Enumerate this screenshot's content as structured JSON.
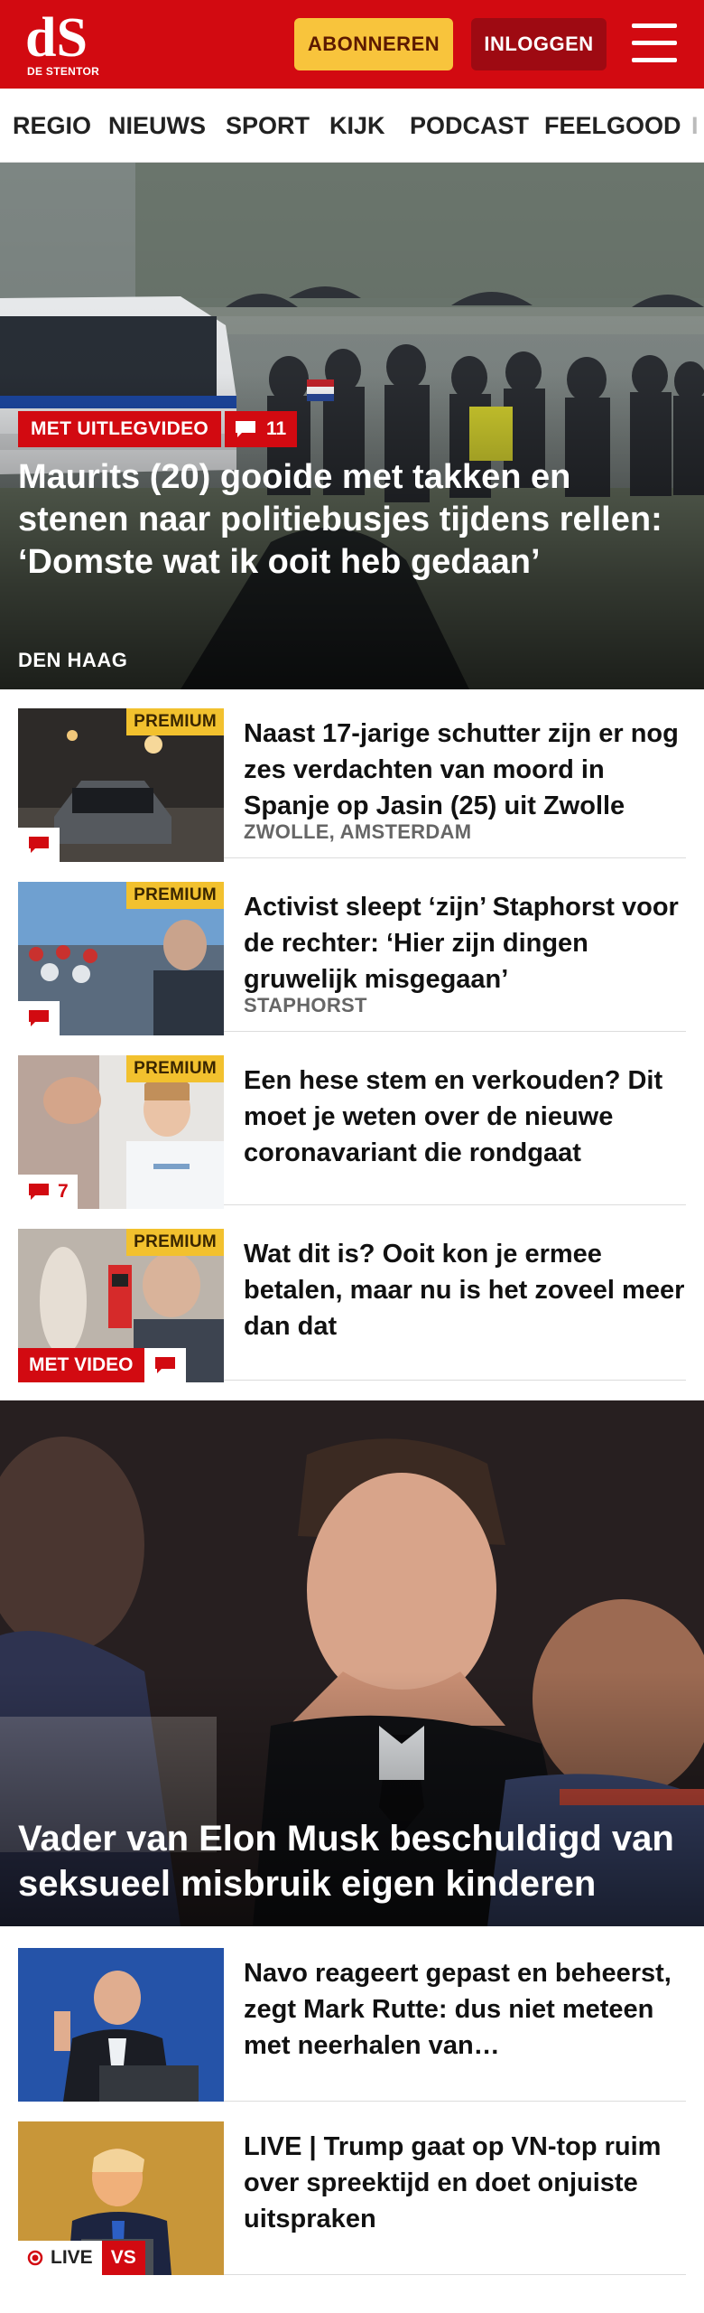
{
  "header": {
    "logo_text": "dS",
    "logo_subtitle": "DE STENTOR",
    "subscribe_label": "ABONNEREN",
    "login_label": "INLOGGEN",
    "brand_color": "#d20a11"
  },
  "nav": {
    "items": [
      "REGIO",
      "NIEUWS",
      "SPORT",
      "KIJK",
      "PODCAST",
      "FEELGOOD",
      "I"
    ]
  },
  "hero": {
    "badge": "MET UITLEGVIDEO",
    "comments": "11",
    "title": "Maurits (20) gooide met takken en stenen naar politiebusjes tijdens rellen: ‘Domste wat ik ooit heb gedaan’",
    "location": "DEN HAAG"
  },
  "articles": [
    {
      "premium": "PREMIUM",
      "comments": "",
      "title": "Naast 17-jarige schutter zijn er nog zes verdachten van moord in Spanje op Jasin (25) uit Zwolle",
      "location": "ZWOLLE, AMSTERDAM"
    },
    {
      "premium": "PREMIUM",
      "comments": "",
      "title": "Activist sleept ‘zijn’ Staphorst voor de rechter: ‘Hier zijn dingen gruwelijk misgegaan’",
      "location": "STAPHORST"
    },
    {
      "premium": "PREMIUM",
      "comments": "7",
      "title": "Een hese stem en verkouden? Dit moet je weten over de nieuwe coronavariant die rondgaat",
      "location": ""
    },
    {
      "premium": "PREMIUM",
      "video_badge": "MET VIDEO",
      "title": "Wat dit is? Ooit kon je ermee betalen, maar nu is het zoveel meer dan dat",
      "location": ""
    }
  ],
  "hero2": {
    "title": "Vader van Elon Musk beschuldigd van seksueel misbruik eigen kinderen"
  },
  "articles2": [
    {
      "title": "Navo reageert gepast en beheerst, zegt Mark Rutte: dus niet meteen met neerhalen van…"
    },
    {
      "title": "LIVE | Trump gaat op VN-top ruim over spreektijd en doet onjuiste uitspraken",
      "live_label": "LIVE",
      "vs_label": "VS"
    }
  ]
}
